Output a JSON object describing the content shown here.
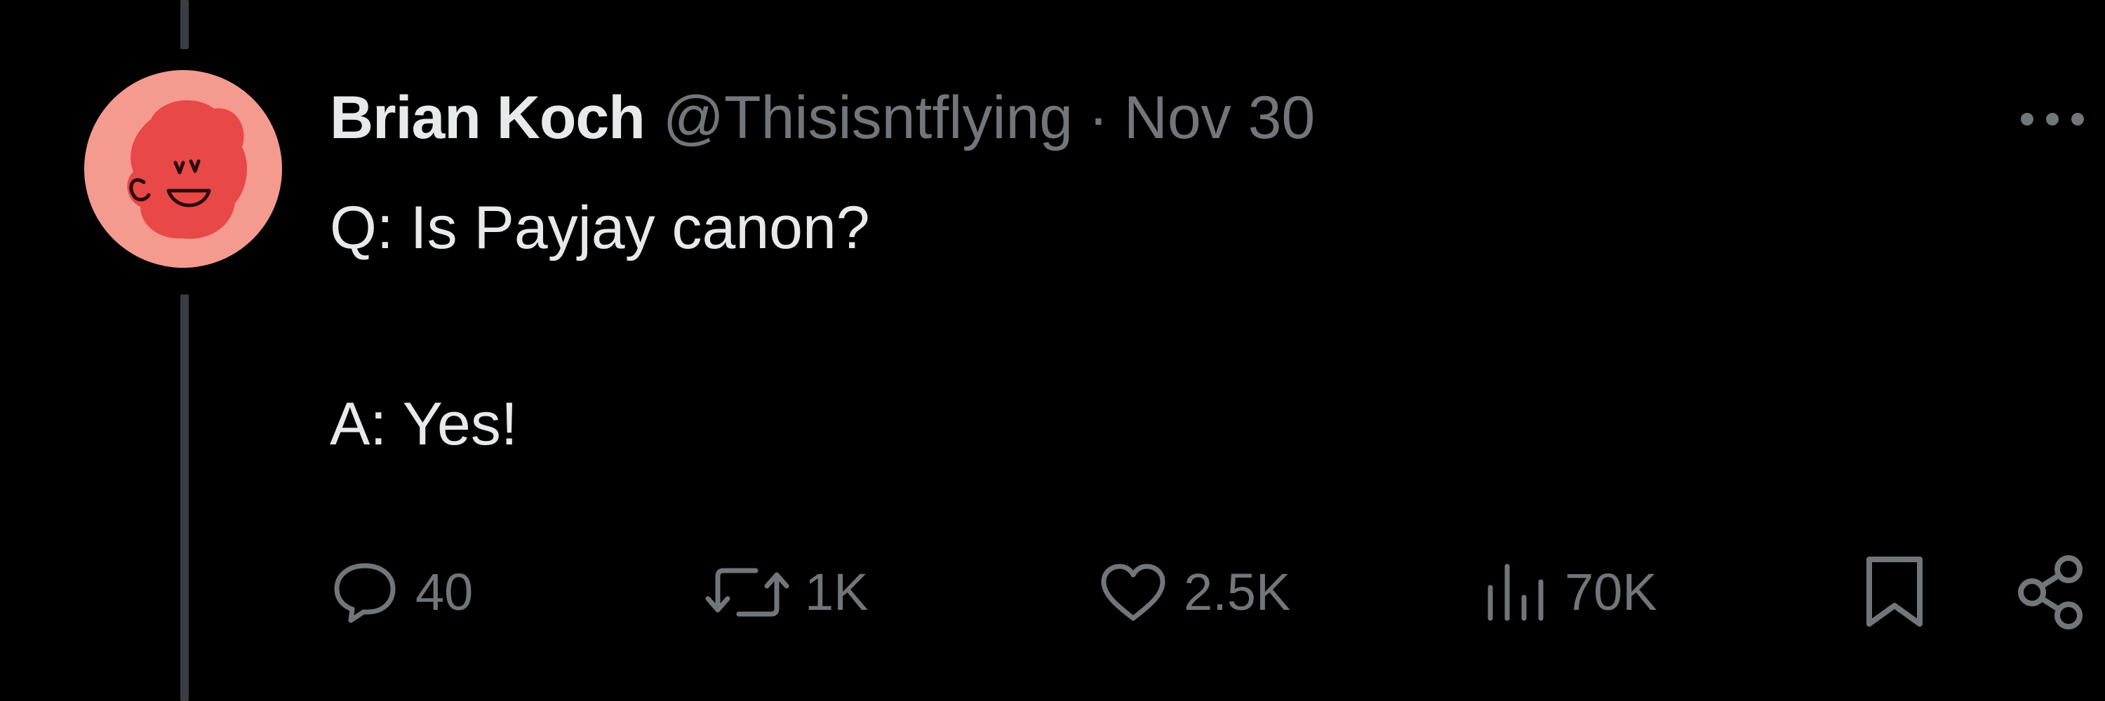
{
  "tweet": {
    "author_name": "Brian Koch",
    "author_handle": "@Thisisntflying",
    "separator": "·",
    "timestamp": "Nov 30",
    "text_lines": [
      "Q: Is Payjay canon?",
      "",
      "A: Yes!"
    ]
  },
  "actions": {
    "reply_count": "40",
    "repost_count": "1K",
    "like_count": "2.5K",
    "views_count": "70K"
  },
  "icons": {
    "more": "more-horizontal-icon",
    "reply": "reply-bubble-icon",
    "repost": "repost-icon",
    "like": "heart-icon",
    "views": "views-bar-chart-icon",
    "bookmark": "bookmark-icon",
    "share": "share-icon"
  },
  "colors": {
    "background": "#000000",
    "primary_text": "#e7e9ea",
    "secondary_text": "#71767b",
    "thread_line": "#3a3d41",
    "avatar_bg": "#f49a8f",
    "avatar_face": "#e84848"
  }
}
